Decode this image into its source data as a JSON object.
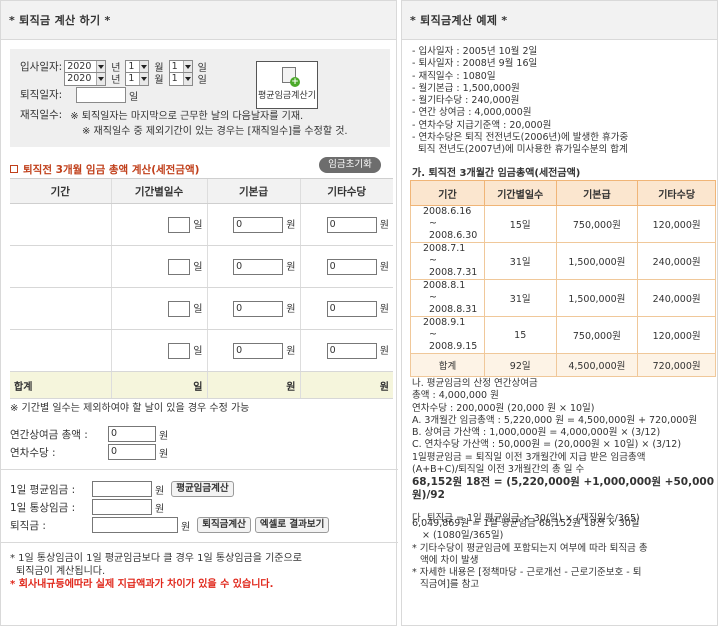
{
  "left": {
    "title": "* 퇴직금 계산 하기 *",
    "join_label": "입사일자:",
    "join_year": "2020",
    "join_month": "1",
    "join_day": "1",
    "retire_label": "퇴직일자:",
    "retire_year": "2020",
    "retire_month": "1",
    "retire_day": "1",
    "unit_year": "년",
    "unit_month": "월",
    "unit_day": "일",
    "avg_calc_button": "평균임금계산기",
    "days_label": "퇴직일자:",
    "days_unit": "일",
    "service_label": "재직일수:",
    "service_note1": "※ 퇴직일자는 마지막으로 근무한 날의 다음날자를 기재.",
    "service_note2": "※ 재직일수 중 제외기간이 있는 경우는 [재직일수]를 수정할 것.",
    "section_title": "퇴직전 3개월 임금 총액 계산(세전금액)",
    "reset_button": "임금초기화",
    "table_headers": [
      "기간",
      "기간별일수",
      "기본급",
      "기타수당"
    ],
    "rows": [
      {
        "days_unit": "일",
        "base": "0",
        "base_unit": "원",
        "etc": "0",
        "etc_unit": "원"
      },
      {
        "days_unit": "일",
        "base": "0",
        "base_unit": "원",
        "etc": "0",
        "etc_unit": "원"
      },
      {
        "days_unit": "일",
        "base": "0",
        "base_unit": "원",
        "etc": "0",
        "etc_unit": "원"
      },
      {
        "days_unit": "일",
        "base": "0",
        "base_unit": "원",
        "etc": "0",
        "etc_unit": "원"
      }
    ],
    "total_label": "합계",
    "total_days": "일",
    "total_base": "원",
    "total_etc": "원",
    "days_note": "※ 기간별 일수는 제외하여야 할 날이 있을 경우 수정 가능",
    "bonus_label": "연간상여금 총액 :",
    "bonus_value": "0",
    "bonus_unit": "원",
    "leave_label": "연차수당 :",
    "leave_value": "0",
    "leave_unit": "원",
    "avg_wage_label": "1일 평균임금 :",
    "avg_wage_unit": "원",
    "avg_wage_button": "평균임금계산",
    "ordinary_wage_label": "1일 통상임금 :",
    "ordinary_wage_unit": "원",
    "severance_label": "퇴직금 :",
    "severance_unit": "원",
    "severance_button": "퇴직금계산",
    "excel_button": "엑셀로 결과보기",
    "foot1": "* 1일 통상임금이 1일 평균임금보다 클 경우 1일 통상임금을 기준으로",
    "foot2": "퇴직금이 계산됩니다.",
    "foot3": "* 회사내규등에따라 실제 지급액과가 차이가 있을 수 있습니다."
  },
  "right": {
    "title": "* 퇴직금계산 예제 *",
    "info": [
      "입사일자 : 2005년 10월 2일",
      "퇴사일자 : 2008년 9월 16일",
      "재직일수 : 1080일",
      "월기본급 : 1,500,000원",
      "월기타수당 : 240,000원",
      "연간 상여금 : 4,000,000원",
      "연차수당 지급기준액 : 20,000원",
      "연차수당은 퇴직 전전년도(2006년)에 발생한 휴가중"
    ],
    "info_cont": "퇴직 전년도(2007년)에 미사용한 휴가일수분의 합계",
    "sub_title": "가. 퇴직전 3개월간 임금총액(세전금액)",
    "table_headers": [
      "기간",
      "기간별일수",
      "기본급",
      "기타수당"
    ],
    "rows": [
      {
        "from": "2008.6.16",
        "to": "~ 2008.6.30",
        "days": "15일",
        "base": "750,000원",
        "etc": "120,000원"
      },
      {
        "from": "2008.7.1",
        "to": "~ 2008.7.31",
        "days": "31일",
        "base": "1,500,000원",
        "etc": "240,000원"
      },
      {
        "from": "2008.8.1",
        "to": "~ 2008.8.31",
        "days": "31일",
        "base": "1,500,000원",
        "etc": "240,000원"
      },
      {
        "from": "2008.9.1",
        "to": "~ 2008.9.15",
        "days": "15",
        "base": "750,000원",
        "etc": "120,000원"
      }
    ],
    "total": {
      "label": "합계",
      "days": "92일",
      "base": "4,500,000원",
      "etc": "720,000원"
    },
    "calc_lines": [
      "나. 평균임금의 산정 연간상여금",
      "총액 : 4,000,000 원",
      "연차수당 : 200,000원 (20,000 원 × 10일)",
      "A. 3개월간 임금총액 : 5,220,000 원 = 4,500,000원 + 720,000원",
      "B. 상여금 가산액 : 1,000,000원 = 4,000,000원 × (3/12)",
      "C. 연차수당 가산액 : 50,000원 = (20,000원 × 10일) × (3/12)",
      "1일평균임금 = 퇴직일 이전 3개월간에 지급 받은 임금총액",
      "(A+B+C)/퇴직일 이전 3개월간의 총 일 수"
    ],
    "calc_bold1": "68,152원 18전 = (5,220,000원 +1,000,000원 +50,000",
    "calc_bold2": "원)/92",
    "severance_formula": "다. 퇴직금 = 1일 평균임금 × 30(일) × (재직일수/365)",
    "result1": "6,049,869원 = 1일 평균임금 68,152원 18전 × 30일",
    "result2": "× (1080일/365일)",
    "note1": "* 기타수당이 평균임금에 포함되는지 여부에 따라 퇴직금 총",
    "note1b": "액에 차이 발생",
    "note2": "* 자세한 내용은 [정책마당 - 근로개선 - 근로기준보호 - 퇴",
    "note2b": "직금여]를 참고"
  }
}
